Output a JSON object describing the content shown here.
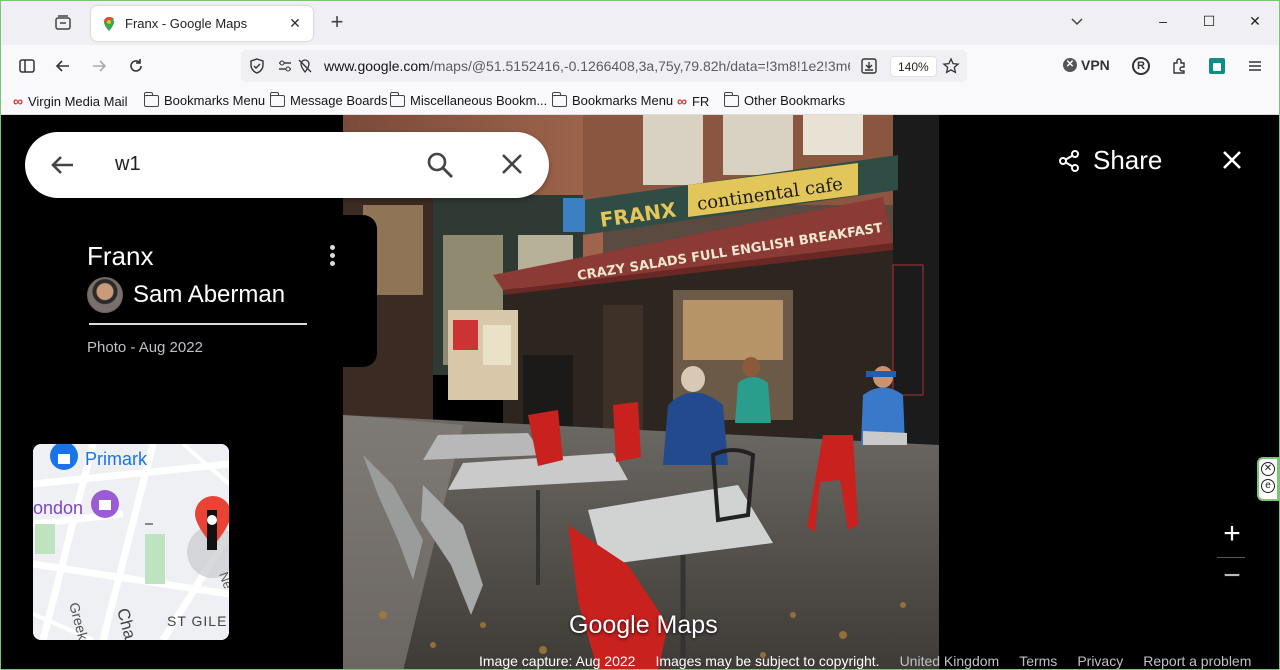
{
  "browser": {
    "tab": {
      "title": "Franx - Google Maps",
      "close": "✕"
    },
    "newtab": "+",
    "window_controls": {
      "minimize": "–",
      "maximize": "☐",
      "close": "✕"
    },
    "url": {
      "host": "www.google.com",
      "path": "/maps/@51.5152416,-0.1266408,3a,75y,79.82h/data=!3m8!1e2!3m6!"
    },
    "zoom": "140%",
    "vpn_label": "VPN",
    "profile_initial": "R"
  },
  "bookmarks": [
    {
      "label": "Virgin Media Mail",
      "icon": "loop-icon"
    },
    {
      "label": "Bookmarks Menu",
      "icon": "folder-icon"
    },
    {
      "label": "Message Boards",
      "icon": "folder-icon"
    },
    {
      "label": "Miscellaneous Bookm...",
      "icon": "folder-icon"
    },
    {
      "label": "Bookmarks Menu",
      "icon": "folder-icon"
    },
    {
      "label": "FR",
      "icon": "loop-icon"
    },
    {
      "label": "Other Bookmarks",
      "icon": "folder-icon"
    }
  ],
  "search": {
    "query": "w1"
  },
  "place": {
    "title": "Franx",
    "author": "Sam Aberman",
    "photo_date": "Photo - Aug 2022"
  },
  "photo_signs": {
    "shop_sign": "continental cafe",
    "awning": "CRAZY SALADS   FULL ENGLISH BREAKFAST",
    "shop_name": "FRANX"
  },
  "minimap": {
    "labels": {
      "primark": "Primark",
      "london": "ondon",
      "st_giles": "ST GILE",
      "greek": "Greek",
      "charing": "Cha",
      "ne": "Ne"
    }
  },
  "share_label": "Share",
  "zoom_controls": {
    "in": "+",
    "out": "−"
  },
  "brand": "Google Maps",
  "footer": {
    "capture": "Image capture: Aug 2022",
    "copyright": "Images may be subject to copyright.",
    "links": [
      "United Kingdom",
      "Terms",
      "Privacy",
      "Report a problem"
    ]
  },
  "colors": {
    "maps_red": "#ea4335",
    "map_blue": "#1a73e8",
    "accent_green": "#7cc576"
  }
}
